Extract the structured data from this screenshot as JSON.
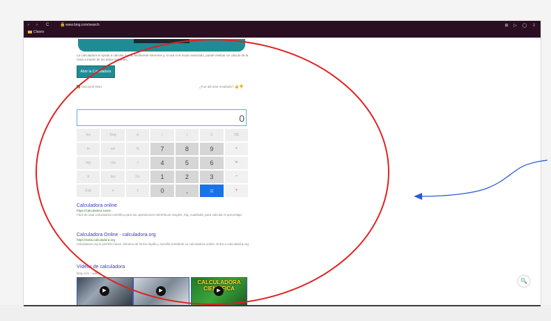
{
  "browser": {
    "back": "‹",
    "forward": "›",
    "reload": "C",
    "address": "www.bing.com/search",
    "bookmark_label": "Clases",
    "toolbar_icons": "⊞ ▷ ◯ ⇩"
  },
  "page": {
    "description": "La calculadora le ayuda a calcular suma, fácilmente intereses y, si usa si el modo avanzado, puede realizar un cálculo de la resta a través de los datos restantes.",
    "calc_button": "Abrir la Calculadora",
    "ms_logo": "Microsoft Start",
    "feedback": "¿Fue útil este resultado?",
    "display_value": "0",
    "keys": [
      {
        "label": "Inv",
        "kind": "fn"
      },
      {
        "label": "Deg",
        "kind": "fn"
      },
      {
        "label": "x!",
        "kind": "fn"
      },
      {
        "label": "(",
        "kind": "fn"
      },
      {
        "label": ")",
        "kind": "fn"
      },
      {
        "label": "C",
        "kind": "fn"
      },
      {
        "label": "⌫",
        "kind": "fn"
      },
      {
        "label": "ln",
        "kind": "fn"
      },
      {
        "label": "sin",
        "kind": "fn"
      },
      {
        "label": "%",
        "kind": "fn"
      },
      {
        "label": "7",
        "kind": "num"
      },
      {
        "label": "8",
        "kind": "num"
      },
      {
        "label": "9",
        "kind": "num"
      },
      {
        "label": "÷",
        "kind": "op"
      },
      {
        "label": "log",
        "kind": "fn"
      },
      {
        "label": "cos",
        "kind": "fn"
      },
      {
        "label": "√",
        "kind": "fn"
      },
      {
        "label": "4",
        "kind": "num"
      },
      {
        "label": "5",
        "kind": "num"
      },
      {
        "label": "6",
        "kind": "num"
      },
      {
        "label": "×",
        "kind": "op"
      },
      {
        "label": "π",
        "kind": "fn"
      },
      {
        "label": "tan",
        "kind": "fn"
      },
      {
        "label": "1/x",
        "kind": "fn"
      },
      {
        "label": "1",
        "kind": "num"
      },
      {
        "label": "2",
        "kind": "num"
      },
      {
        "label": "3",
        "kind": "num"
      },
      {
        "label": "−",
        "kind": "op"
      },
      {
        "label": "Exp",
        "kind": "fn"
      },
      {
        "label": "e",
        "kind": "fn"
      },
      {
        "label": "±",
        "kind": "fn"
      },
      {
        "label": "0",
        "kind": "num"
      },
      {
        "label": ",",
        "kind": "num"
      },
      {
        "label": "=",
        "kind": "eq"
      },
      {
        "label": "+",
        "kind": "op"
      }
    ],
    "results": [
      {
        "title": "Calculadora online",
        "url": "https://calculadora.name",
        "snippet_bold": "calculadora",
        "snippet": "Fácil de usar calculadora científica para las operaciones aritméticas simples, trig, cuadrada, para calcular el porcentaje."
      },
      {
        "title": "Calculadora Online - calculadora.org",
        "url": "https://www.calculadora.org",
        "snippet_bold": "calculadora",
        "snippet": "calculadora.org te permite hacer cálculos de forma rápida y sencilla mediante su calculadora online. Entra a calculadora.org."
      }
    ],
    "videos_title": "Vídeos de calculadora",
    "videos_sub": "bing.com › videos",
    "video3_text": "CALCULADORA CIENTÍFICA",
    "play_icon": "▶",
    "search_fab_icon": "🔍"
  },
  "colors": {
    "annotation_red": "#e02020",
    "annotation_blue": "#2a5bd7"
  }
}
